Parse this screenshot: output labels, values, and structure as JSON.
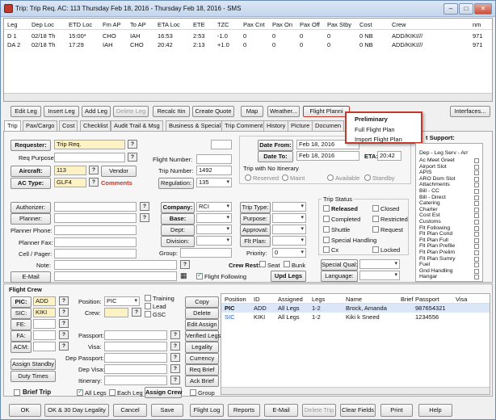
{
  "window": {
    "title": "Trip: Trip Req.  AC: 113  Thursday Feb 18, 2016 - Thursday Feb 18, 2016 - SMS"
  },
  "legs": {
    "headers": [
      "Leg",
      "Dep Loc",
      "ETD Loc",
      "Fm AP",
      "To AP",
      "ETA Loc",
      "ETE",
      "TZC",
      "Pax Cnt",
      "Pax On",
      "Pax Off",
      "Pax Stby",
      "Cost",
      "Crew",
      "nm"
    ],
    "rows": [
      [
        "D 1",
        "02/18 Th",
        "15:00*",
        "CHO",
        "IAH",
        "16:53",
        "2:53",
        "-1.0",
        "0",
        "0",
        "0",
        "0",
        "0 NB",
        "ADD/KIKI///",
        "971"
      ],
      [
        "DA 2",
        "02/18 Th",
        "17:29",
        "IAH",
        "CHO",
        "20:42",
        "2:13",
        "+1.0",
        "0",
        "0",
        "0",
        "0",
        "0 NB",
        "ADD/KIKI///",
        "971"
      ]
    ]
  },
  "toolbar": {
    "edit_leg": "Edit Leg",
    "insert_leg": "Insert Leg",
    "add_leg": "Add Leg",
    "delete_leg": "Delete Leg",
    "recalc": "Recalc Itin",
    "create_quote": "Create Quote",
    "map": "Map",
    "weather": "Weather...",
    "flight_plan": "Flight Planni",
    "interfaces": "Interfaces..."
  },
  "menu": {
    "items": [
      "Preliminary",
      "Full Flight Plan",
      "Import Flight Plan"
    ]
  },
  "tabs": [
    "Trip",
    "Pax/Cargo",
    "Cost",
    "Checklist",
    "Audit Trail & Msg",
    "Business & Special",
    "Trip Comment",
    "History",
    "Picture",
    "Documen"
  ],
  "trip": {
    "requester_label": "Requester:",
    "requester": "Trip Req.",
    "req_purpose_label": "Req Purpose:",
    "aircraft_label": "Aircraft:",
    "aircraft": "113",
    "vendor": "Vendor",
    "ac_type_label": "AC Type:",
    "ac_type": "GLF4",
    "comments": "Comments",
    "flight_number_label": "Flight Number:",
    "trip_number_label": "Trip Number:",
    "trip_number": "1492",
    "regulation_label": "Regulation:",
    "regulation": "135",
    "date_from_label": "Date From:",
    "date_from": "Feb 18, 2016",
    "date_to_label": "Date To:",
    "date_to": "Feb 18, 2016",
    "eta_label": "ETA:",
    "eta": "20:42",
    "no_itin": "Trip with No Itinerary",
    "reserved": "Reserved",
    "maint": "Maint",
    "available": "Available",
    "standby": "Standby",
    "authorizer": "Authorizer:",
    "planner": "Planner:",
    "planner_phone": "Planner Phone:",
    "planner_fax": "Planner Fax:",
    "cell_pager": "Cell / Pager:",
    "note": "Note:",
    "email": "E-Mail",
    "company_label": "Company:",
    "company": "RCI",
    "base": "Base:",
    "dept": "Dept:",
    "division": "Division:",
    "group": "Group:",
    "trip_type": "Trip Type:",
    "purpose": "Purpose:",
    "approval": "Approval:",
    "flt_plan": "Flt Plan:",
    "priority": "Priority:",
    "priority_val": "0",
    "crew_rest": "Crew Rest:",
    "seat": "Seat",
    "bunk": "Bunk",
    "flight_following": "Flight Following",
    "upd_legs": "Upd Legs",
    "trip_status": "Trip Status",
    "released": "Released",
    "closed": "Closed",
    "completed": "Completed",
    "restricted": "Restricted",
    "shuttle": "Shuttle",
    "request": "Request",
    "special_handling": "Special Handling",
    "cx": "Cx",
    "locked": "Locked",
    "special_qual": "Special Qual:",
    "language": "Language:"
  },
  "support": {
    "title": "t Support:",
    "header": "Dep - Leg Serv - Arr",
    "items": [
      "Ac Meet Greet",
      "Airport Slot",
      "APIS",
      "ARO Dom Slot",
      "Attachments",
      "Bill - CC",
      "Bill - Direct",
      "Catering",
      "Charter",
      "Cost Est",
      "Customs",
      "Flt Following",
      "Flt Plan Cond",
      "Flt Plan Full",
      "Flt Plan Prefile",
      "Flt Plan Prelim",
      "Flt Plan Sumry",
      "Fuel",
      "Gnd Handling",
      "Hangar"
    ]
  },
  "crew": {
    "title": "Flight Crew",
    "pic": "PIC:",
    "pic_val": "ADD",
    "sic": "SIC:",
    "sic_val": "KIKI",
    "fe": "FE:",
    "fa": "FA:",
    "acm": "ACM:",
    "position_label": "Position:",
    "position": "PIC",
    "training": "Training",
    "lead": "Lead",
    "gsc": "GSC",
    "crew_label": "Crew:",
    "passport": "Passport:",
    "visa": "Visa:",
    "dep_passport": "Dep Passport:",
    "dep_visa": "Dep Visa:",
    "itinerary": "Itinerary:",
    "assign_standby": "Assign Standby",
    "duty_times": "Duty Times",
    "brief_trip": "Brief Trip",
    "all_legs": "All Legs",
    "each_leg": "Each Leg",
    "assign_crew": "Assign Crew",
    "group": "Group",
    "copy": "Copy",
    "delete": "Delete",
    "edit_assign": "Edit Assign",
    "verified_legs": "Verified Legs",
    "legality": "Legality",
    "currency": "Currency",
    "req_brief": "Req Brief",
    "ack_brief": "Ack Brief",
    "grid_headers": [
      "Position",
      "ID",
      "Assigned",
      "Legs",
      "Name",
      "Brief",
      "Passport",
      "Visa"
    ],
    "grid_rows": [
      [
        "PIC",
        "ADD",
        "All Legs",
        "1-2",
        "Brock, Amanda",
        "",
        "987654321",
        ""
      ],
      [
        "SIC",
        "KIKI",
        "All Legs",
        "1-2",
        "Kiki k Sneed",
        "",
        "1234556",
        ""
      ]
    ]
  },
  "footer": {
    "ok": "OK",
    "ok30": "OK & 30 Day Legality",
    "cancel": "Cancel",
    "save": "Save",
    "flight_log": "Flight Log",
    "reports": "Reports",
    "email": "E-Mail",
    "delete_trip": "Delete Trip",
    "clear_fields": "Clear Fields",
    "print": "Print",
    "help": "Help"
  },
  "colors": {
    "accent_red": "#c0392b",
    "yellow_field": "#fdf2c4"
  }
}
